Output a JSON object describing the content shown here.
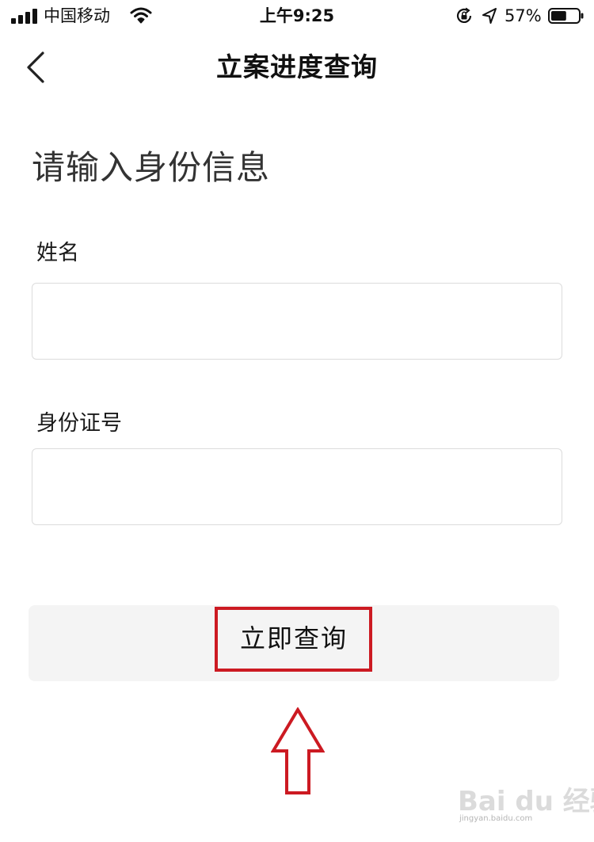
{
  "status_bar": {
    "carrier": "中国移动",
    "time": "上午9:25",
    "battery_percent": "57%",
    "battery_level": 0.57,
    "icons": [
      "signal-icon",
      "wifi-icon",
      "rotation-lock-icon",
      "location-icon",
      "battery-icon"
    ]
  },
  "nav": {
    "title": "立案进度查询",
    "back_icon": "chevron-left-icon"
  },
  "form": {
    "heading": "请输入身份信息",
    "name_label": "姓名",
    "name_value": "",
    "id_label": "身份证号",
    "id_value": "",
    "submit_label": "立即查询"
  },
  "annotation": {
    "highlight_color": "#cc1a22",
    "arrow_icon": "arrow-up-icon"
  },
  "watermark": {
    "text": "Bai du 经验",
    "sub": "jingyan.baidu.com"
  }
}
